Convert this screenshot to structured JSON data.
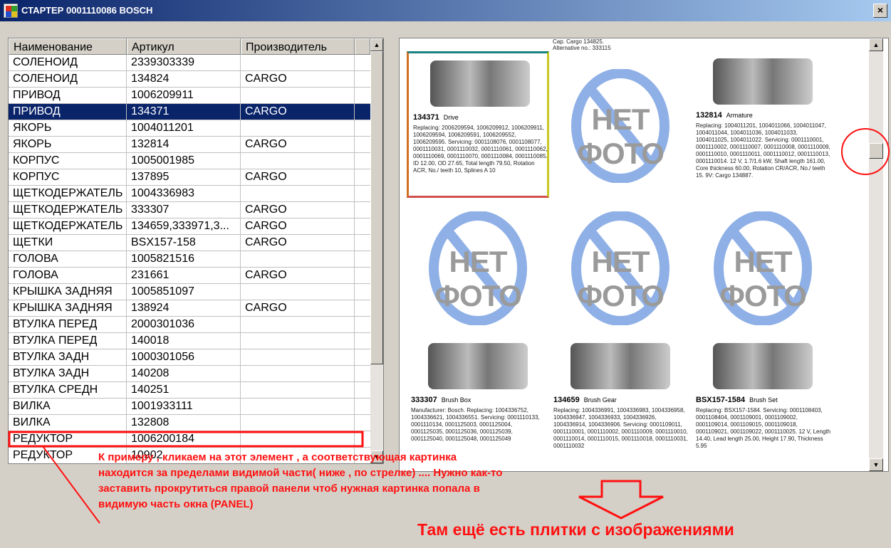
{
  "window": {
    "title": "СТАРТЕР 0001110086 BOSCH",
    "close_label": "×"
  },
  "grid": {
    "headers": [
      "Наименование",
      "Артикул",
      "Производитель"
    ],
    "rows": [
      {
        "name": "СОЛЕНОИД",
        "article": "2339303339",
        "maker": ""
      },
      {
        "name": "СОЛЕНОИД",
        "article": "134824",
        "maker": "CARGO"
      },
      {
        "name": "ПРИВОД",
        "article": "1006209911",
        "maker": ""
      },
      {
        "name": "ПРИВОД",
        "article": "134371",
        "maker": "CARGO",
        "selected": true
      },
      {
        "name": "ЯКОРЬ",
        "article": "1004011201",
        "maker": ""
      },
      {
        "name": "ЯКОРЬ",
        "article": "132814",
        "maker": "CARGO"
      },
      {
        "name": "КОРПУС",
        "article": "1005001985",
        "maker": ""
      },
      {
        "name": "КОРПУС",
        "article": "137895",
        "maker": "CARGO"
      },
      {
        "name": "ЩЕТКОДЕРЖАТЕЛЬ",
        "article": "1004336983",
        "maker": ""
      },
      {
        "name": "ЩЕТКОДЕРЖАТЕЛЬ",
        "article": "333307",
        "maker": "CARGO"
      },
      {
        "name": "ЩЕТКОДЕРЖАТЕЛЬ",
        "article": "134659,333971,3...",
        "maker": "CARGO"
      },
      {
        "name": "ЩЕТКИ",
        "article": "BSX157-158",
        "maker": "CARGO"
      },
      {
        "name": "ГОЛОВА",
        "article": "1005821516",
        "maker": ""
      },
      {
        "name": "ГОЛОВА",
        "article": "231661",
        "maker": "CARGO"
      },
      {
        "name": "КРЫШКА ЗАДНЯЯ",
        "article": "1005851097",
        "maker": ""
      },
      {
        "name": "КРЫШКА ЗАДНЯЯ",
        "article": "138924",
        "maker": "CARGO"
      },
      {
        "name": "ВТУЛКА ПЕРЕД",
        "article": "2000301036",
        "maker": ""
      },
      {
        "name": "ВТУЛКА ПЕРЕД",
        "article": "140018",
        "maker": ""
      },
      {
        "name": "ВТУЛКА ЗАДН",
        "article": "1000301056",
        "maker": ""
      },
      {
        "name": "ВТУЛКА ЗАДН",
        "article": "140208",
        "maker": ""
      },
      {
        "name": "ВТУЛКА СРЕДН",
        "article": "140251",
        "maker": ""
      },
      {
        "name": "ВИЛКА",
        "article": "1001933111",
        "maker": ""
      },
      {
        "name": "ВИЛКА",
        "article": "132808",
        "maker": ""
      },
      {
        "name": "РЕДУКТОР",
        "article": "1006200184",
        "maker": ""
      },
      {
        "name": "РЕДУКТОР",
        "article": "10902",
        "maker": ""
      }
    ]
  },
  "panel": {
    "no_photo_label": "НЕТ ФОТО",
    "top_caption": "Cap. Cargo 134825.",
    "top_caption2": "Alternative no.: 333115",
    "tiles": [
      {
        "code": "134371",
        "type": "Drive",
        "desc": "Replacing: 2006209594, 1006209912, 1006209911, 1006209594, 1006209591, 1006209552, 1006209595. Servicing: 0001108076, 0001108077, 0001110031, 0001110032, 0001110061, 0001110062, 0001110069, 0001110070, 0001110084, 0001110085. ID 12.00, OD 27.65, Total length 79.50, Rotation ACR, No./ teeth 10, Splines A 10"
      },
      {
        "code": "",
        "type": "",
        "desc": "",
        "nophoto": true
      },
      {
        "code": "132814",
        "type": "Armature",
        "desc": "Replacing: 1004011201, 1004011066, 1004011047, 1004011044, 1004011036, 1004011033, 1004011025, 1004011022. Servicing: 0001110001, 0001110002, 0001110007, 0001110008, 0001110009, 0001110010, 0001110011, 0001110012, 0001110013, 0001110014. 12 V, 1.7/1.6 kW, Shaft length 161.00, Core thickness 60.00, Rotation CR/ACR, No./ teeth 15. 9V: Cargo 134887."
      },
      {
        "code": "",
        "type": "",
        "desc": "",
        "nophoto": true
      },
      {
        "code": "",
        "type": "",
        "desc": "",
        "nophoto": true
      },
      {
        "code": "",
        "type": "",
        "desc": "",
        "nophoto": true
      },
      {
        "code": "333307",
        "type": "Brush Box",
        "desc": "Manufacturer: Bosch. Replacing: 1004336752, 1004336621, 1004336551. Servicing: 0001110133, 0001110134, 0001125003, 0001125004, 0001125035, 0001125036, 0001125039, 0001125040, 0001125048, 0001125049"
      },
      {
        "code": "134659",
        "type": "Brush Gear",
        "desc": "Replacing: 1004336991, 1004336983, 1004336958, 1004336947, 1004336933, 1004336926, 1004336914, 1004336906. Servicing: 0001109011, 0001110001, 0001110002, 0001110009, 0001110010, 0001110014, 0001110015, 0001110018, 0001110031, 0001110032"
      },
      {
        "code": "BSX157-1584",
        "type": "Brush Set",
        "desc": "Replacing: BSX157-1584. Servicing: 0001108403, 0001108404, 0001109001, 0001109002, 0001109014, 0001109015, 0001109018, 0001109021, 0001109022, 0001110025. 12 V, Length 14.40, Lead length 25.00, Height 17.90, Thickness 5.95"
      }
    ]
  },
  "annotation": {
    "text": "К примеру , кликаем на этот элемент , а соответствующая картинка находится за пределами видимой части( ниже , по стрелке) .... Нужно как-то заставить прокрутиться правой панели чтоб нужная картинка попала в видимую часть окна (PANEL)",
    "bottom_text": "Там ещё есть плитки с изображениями",
    "color": "#ff1010"
  },
  "icons": {
    "scroll_up": "▲",
    "scroll_down": "▼"
  }
}
